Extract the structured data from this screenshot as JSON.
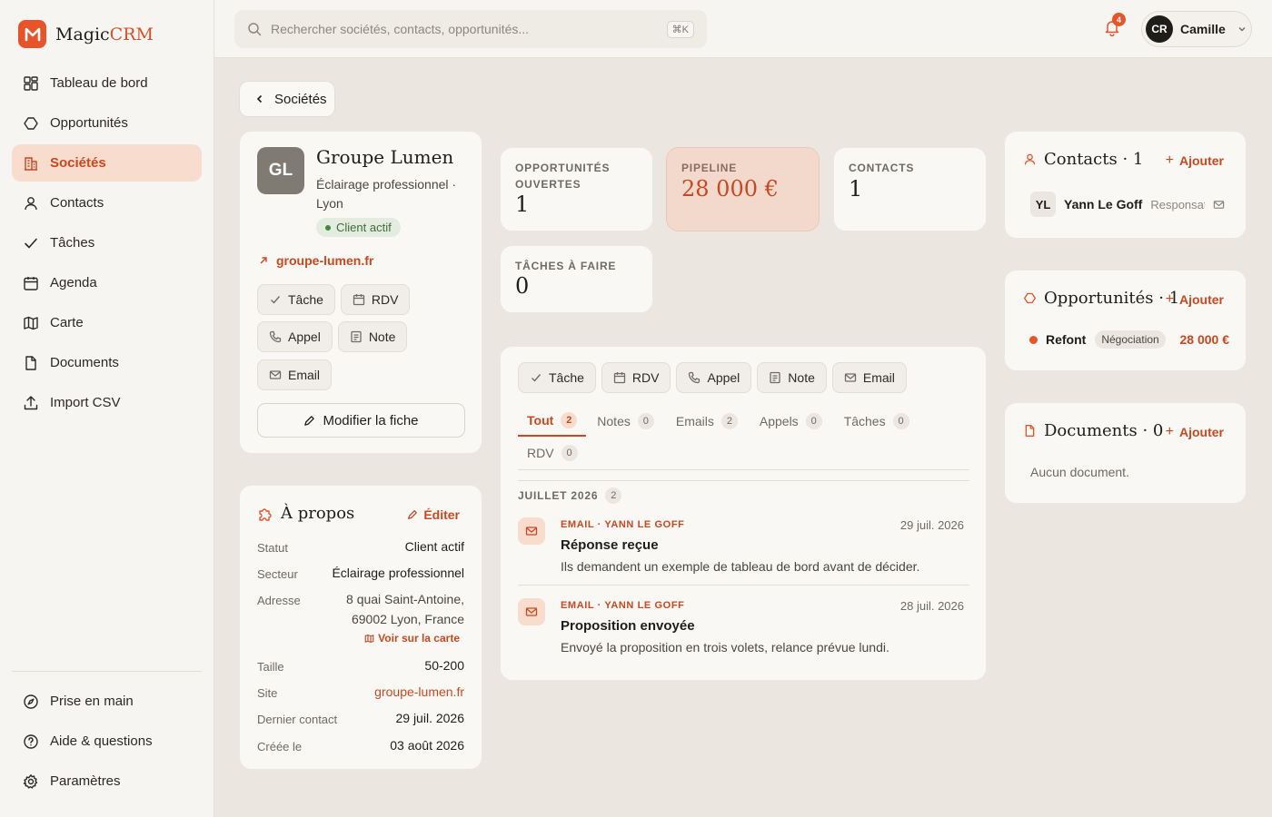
{
  "app": {
    "name_prefix": "Magic",
    "name_suffix": "CRM",
    "brand_color": "#e8542a"
  },
  "sidebar": {
    "items": [
      {
        "label": "Tableau de bord",
        "icon": "dashboard-icon"
      },
      {
        "label": "Opportunités",
        "icon": "hexagon-icon"
      },
      {
        "label": "Sociétés",
        "icon": "building-icon",
        "active": true
      },
      {
        "label": "Contacts",
        "icon": "user-icon"
      },
      {
        "label": "Tâches",
        "icon": "check-icon"
      },
      {
        "label": "Agenda",
        "icon": "calendar-icon"
      },
      {
        "label": "Carte",
        "icon": "map-icon"
      },
      {
        "label": "Documents",
        "icon": "file-icon"
      },
      {
        "label": "Import CSV",
        "icon": "upload-icon"
      }
    ],
    "footer": [
      {
        "label": "Prise en main",
        "icon": "compass-icon"
      },
      {
        "label": "Aide & questions",
        "icon": "help-icon"
      },
      {
        "label": "Paramètres",
        "icon": "gear-icon"
      }
    ]
  },
  "topbar": {
    "search_placeholder": "Rechercher sociétés, contacts, opportunités...",
    "shortcut": "⌘K",
    "notifications": "4",
    "user_initials": "CR",
    "user_name": "Camille"
  },
  "back_label": "Sociétés",
  "company": {
    "initials": "GL",
    "name": "Groupe Lumen",
    "subtitle": "Éclairage professionnel · Lyon",
    "status_badge": "Client actif",
    "website": "groupe-lumen.fr",
    "actions": [
      "Tâche",
      "RDV",
      "Appel",
      "Note",
      "Email"
    ],
    "edit_label": "Modifier la fiche"
  },
  "about": {
    "title": "À propos",
    "edit_label": "Éditer",
    "rows": {
      "statut": {
        "label": "Statut",
        "value": "Client actif"
      },
      "secteur": {
        "label": "Secteur",
        "value": "Éclairage professionnel"
      },
      "adresse": {
        "label": "Adresse",
        "line1": "8 quai Saint-Antoine,",
        "line2": "69002 Lyon, France",
        "map_link": "Voir sur la carte"
      },
      "taille": {
        "label": "Taille",
        "value": "50-200"
      },
      "site": {
        "label": "Site",
        "value": "groupe-lumen.fr"
      },
      "dernier": {
        "label": "Dernier contact",
        "value": "29 juil. 2026"
      },
      "creee": {
        "label": "Créée le",
        "value": "03 août 2026"
      }
    }
  },
  "stats": {
    "open_opps": {
      "label": "Opportunités ouvertes",
      "value": "1"
    },
    "pipeline": {
      "label": "Pipeline",
      "value": "28 000 €"
    },
    "contacts": {
      "label": "Contacts",
      "value": "1"
    },
    "tasks": {
      "label": "Tâches à faire",
      "value": "0"
    }
  },
  "activity": {
    "actions": [
      "Tâche",
      "RDV",
      "Appel",
      "Note",
      "Email"
    ],
    "tabs": [
      {
        "label": "Tout",
        "count": "2"
      },
      {
        "label": "Notes",
        "count": "0"
      },
      {
        "label": "Emails",
        "count": "2"
      },
      {
        "label": "Appels",
        "count": "0"
      },
      {
        "label": "Tâches",
        "count": "0"
      },
      {
        "label": "RDV",
        "count": "0"
      }
    ],
    "month": "Juillet 2026",
    "month_count": "2",
    "items": [
      {
        "kind": "EMAIL · YANN LE GOFF",
        "date": "29 juil. 2026",
        "title": "Réponse reçue",
        "body": "Ils demandent un exemple de tableau de bord avant de décider."
      },
      {
        "kind": "EMAIL · YANN LE GOFF",
        "date": "28 juil. 2026",
        "title": "Proposition envoyée",
        "body": "Envoyé la proposition en trois volets, relance prévue lundi."
      }
    ]
  },
  "contacts_panel": {
    "title": "Contacts · 1",
    "add_label": "Ajouter",
    "items": [
      {
        "initials": "YL",
        "name": "Yann Le Goff",
        "role": "Responsat"
      }
    ]
  },
  "opps_panel": {
    "title": "Opportunités · 1",
    "add_label": "Ajouter",
    "items": [
      {
        "name": "Refont",
        "stage": "Négociation",
        "amount": "28 000 €"
      }
    ]
  },
  "docs_panel": {
    "title": "Documents · 0",
    "add_label": "Ajouter",
    "empty": "Aucun document."
  }
}
